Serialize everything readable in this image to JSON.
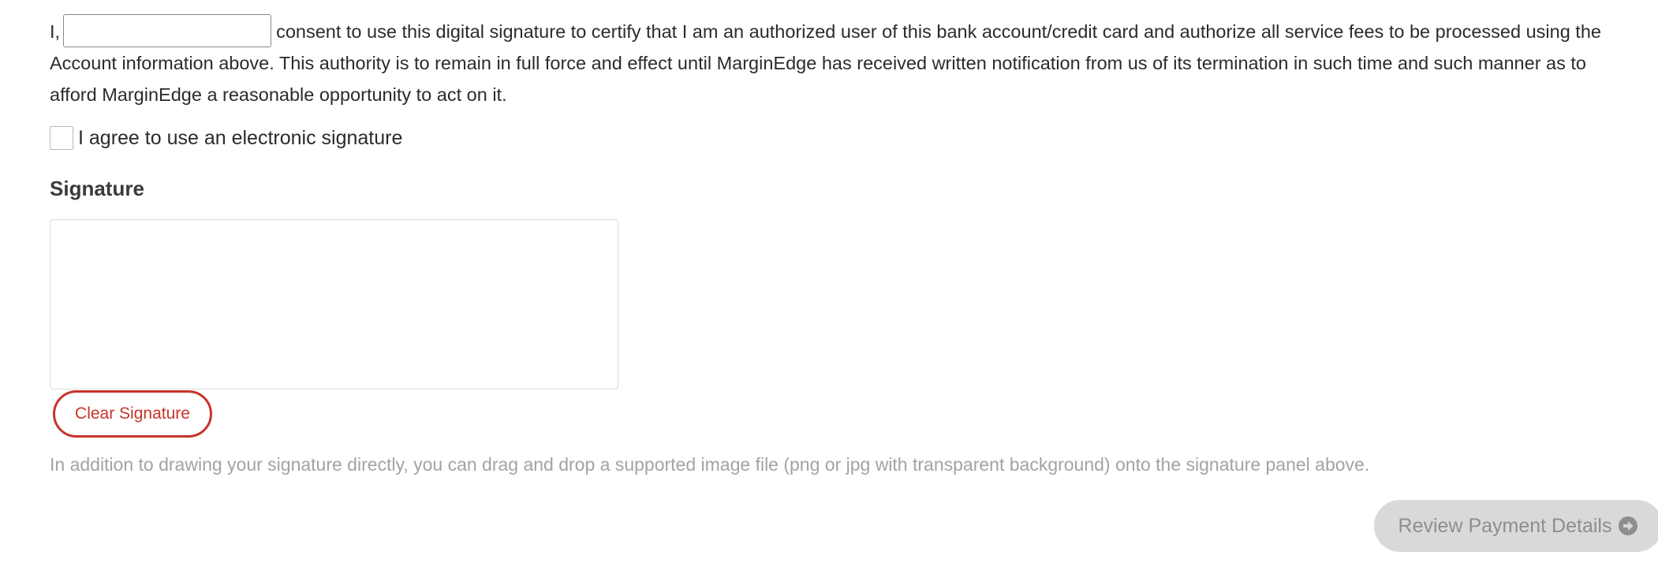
{
  "consent": {
    "prefix": "I,",
    "name_value": "",
    "text": "consent to use this digital signature to certify that I am an authorized user of this bank account/credit card and authorize all service fees to be processed using the Account information above. This authority is to remain in full force and effect until MarginEdge has received written notification from us of its termination in such time and such manner as to afford MarginEdge a reasonable opportunity to act on it."
  },
  "agree": {
    "checked": false,
    "label": "I agree to use an electronic signature"
  },
  "signature": {
    "heading": "Signature",
    "clear_label": "Clear Signature",
    "help_text": "In addition to drawing your signature directly, you can drag and drop a supported image file (png or jpg with transparent background) onto the signature panel above."
  },
  "actions": {
    "review_label": "Review Payment Details",
    "review_icon": "arrow-circle-right-icon"
  },
  "colors": {
    "accent": "#c8342a",
    "disabled_bg": "#d9d9d9",
    "disabled_text": "#8e8e8e",
    "muted_text": "#a3a3a3"
  }
}
